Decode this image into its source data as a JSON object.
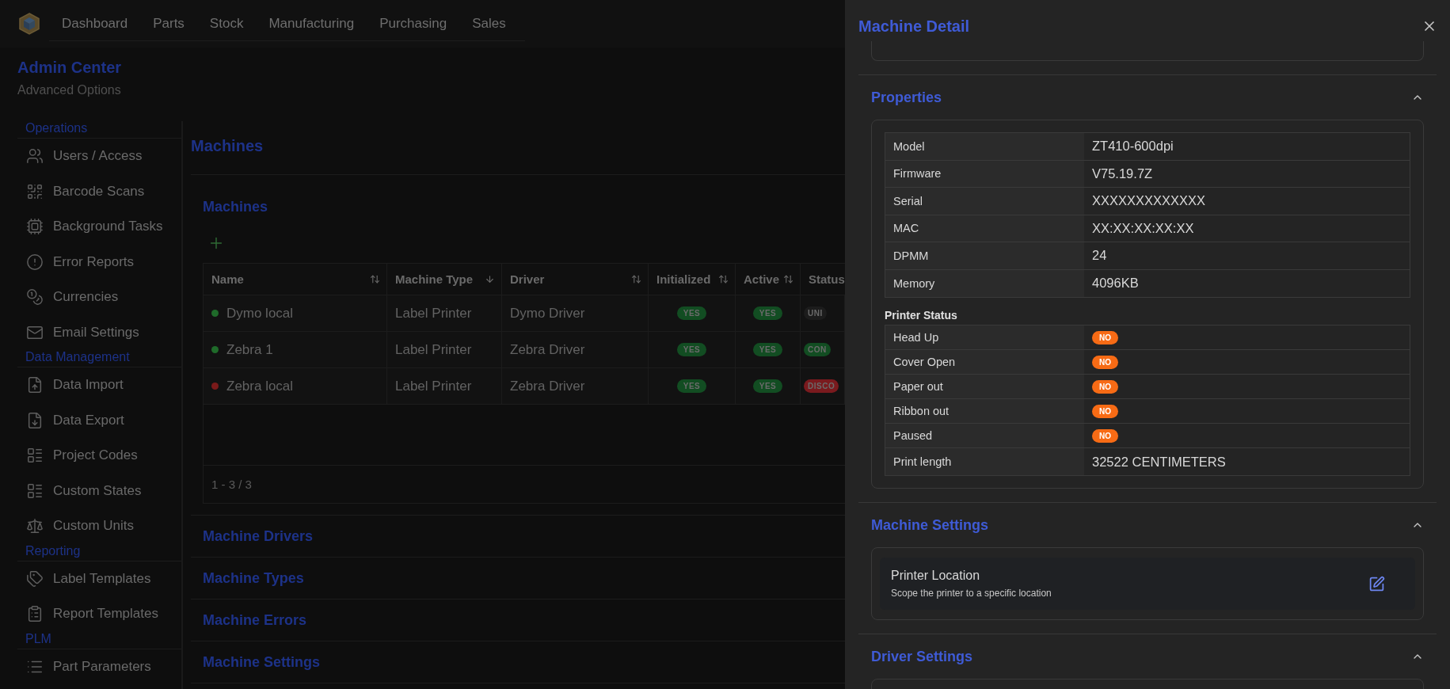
{
  "nav": {
    "tabs": [
      {
        "label": "Dashboard"
      },
      {
        "label": "Parts"
      },
      {
        "label": "Stock"
      },
      {
        "label": "Manufacturing"
      },
      {
        "label": "Purchasing"
      },
      {
        "label": "Sales"
      }
    ]
  },
  "page": {
    "title": "Admin Center",
    "subtitle": "Advanced Options"
  },
  "sidebar": {
    "sections": [
      {
        "title": "Operations",
        "items": [
          {
            "label": "Users / Access"
          },
          {
            "label": "Barcode Scans"
          },
          {
            "label": "Background Tasks"
          },
          {
            "label": "Error Reports"
          },
          {
            "label": "Currencies"
          },
          {
            "label": "Email Settings"
          }
        ]
      },
      {
        "title": "Data Management",
        "items": [
          {
            "label": "Data Import"
          },
          {
            "label": "Data Export"
          },
          {
            "label": "Project Codes"
          },
          {
            "label": "Custom States"
          },
          {
            "label": "Custom Units"
          }
        ]
      },
      {
        "title": "Reporting",
        "items": [
          {
            "label": "Label Templates"
          },
          {
            "label": "Report Templates"
          }
        ]
      },
      {
        "title": "PLM",
        "items": [
          {
            "label": "Part Parameters"
          }
        ]
      }
    ]
  },
  "main": {
    "title": "Machines",
    "panel": {
      "title": "Machines",
      "table": {
        "columns": [
          {
            "label": "Name",
            "sorted": false
          },
          {
            "label": "Machine Type",
            "sorted": true
          },
          {
            "label": "Driver",
            "sorted": false
          },
          {
            "label": "Initialized",
            "sorted": false
          },
          {
            "label": "Active",
            "sorted": false
          },
          {
            "label": "Status"
          }
        ],
        "rows": [
          {
            "name": "Dymo local",
            "color": "#1f6b2a",
            "type": "Label Printer",
            "driver": "Dymo Driver",
            "initialized": "YES",
            "active": "YES",
            "status": {
              "label": "UNI",
              "color": "#1c1c1c"
            }
          },
          {
            "name": "Zebra 1",
            "color": "#1f6b2a",
            "type": "Label Printer",
            "driver": "Zebra Driver",
            "initialized": "YES",
            "active": "YES",
            "status": {
              "label": "CON",
              "color": "#124d22"
            }
          },
          {
            "name": "Zebra local",
            "color": "#7a1a1a",
            "type": "Label Printer",
            "driver": "Zebra Driver",
            "initialized": "YES",
            "active": "YES",
            "status": {
              "label": "DISCO",
              "color": "#7a1a1e"
            }
          }
        ],
        "footer": "1 - 3 / 3"
      }
    },
    "sections": [
      {
        "title": "Machine Drivers"
      },
      {
        "title": "Machine Types"
      },
      {
        "title": "Machine Errors"
      },
      {
        "title": "Machine Settings"
      }
    ]
  },
  "drawer": {
    "title": "Machine Detail",
    "properties": {
      "title": "Properties",
      "expanded": true,
      "rows": [
        {
          "label": "Model",
          "value": "ZT410-600dpi"
        },
        {
          "label": "Firmware",
          "value": "V75.19.7Z"
        },
        {
          "label": "Serial",
          "value": "XXXXXXXXXXXXX"
        },
        {
          "label": "MAC",
          "value": "XX:XX:XX:XX:XX"
        },
        {
          "label": "DPMM",
          "value": "24"
        },
        {
          "label": "Memory",
          "value": "4096KB"
        }
      ],
      "status_title": "Printer Status",
      "status_rows": [
        {
          "label": "Head Up",
          "kind": "badge",
          "value": "NO"
        },
        {
          "label": "Cover Open",
          "kind": "badge",
          "value": "NO"
        },
        {
          "label": "Paper out",
          "kind": "badge",
          "value": "NO"
        },
        {
          "label": "Ribbon out",
          "kind": "badge",
          "value": "NO"
        },
        {
          "label": "Paused",
          "kind": "badge",
          "value": "NO"
        },
        {
          "label": "Print length",
          "kind": "text",
          "value": "32522 CENTIMETERS"
        }
      ]
    },
    "machine_settings": {
      "title": "Machine Settings",
      "expanded": true,
      "settings": [
        {
          "label": "Printer Location",
          "description": "Scope the printer to a specific location"
        }
      ]
    },
    "driver_settings": {
      "title": "Driver Settings",
      "expanded": true
    }
  }
}
